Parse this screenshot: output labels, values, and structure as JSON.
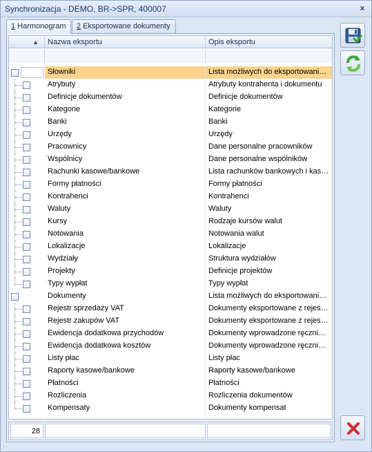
{
  "window": {
    "title": "Synchronizacja - DEMO, BR->SPR, 400007",
    "close_glyph": "×"
  },
  "tabs": [
    {
      "key": "1",
      "label": " Harmonogram",
      "active": true
    },
    {
      "key": "2",
      "label": " Eksportowane dokumenty",
      "active": false
    }
  ],
  "grid": {
    "sort_glyph": "▲",
    "columns": [
      "Nazwa eksportu",
      "Opis eksportu"
    ],
    "rows": [
      {
        "level": 0,
        "name": "Słowniki",
        "desc": "Lista możliwych do eksportowania słowników",
        "selected": true
      },
      {
        "level": 1,
        "name": "Atrybuty",
        "desc": "Atrybuty kontrahenta i dokumentu"
      },
      {
        "level": 1,
        "name": "Definicje dokumentów",
        "desc": "Definicje dokumentów"
      },
      {
        "level": 1,
        "name": "Kategorie",
        "desc": "Kategorie"
      },
      {
        "level": 1,
        "name": "Banki",
        "desc": "Banki"
      },
      {
        "level": 1,
        "name": "Urzędy",
        "desc": "Urzędy"
      },
      {
        "level": 1,
        "name": "Pracownicy",
        "desc": "Dane personalne pracowników"
      },
      {
        "level": 1,
        "name": "Wspólnicy",
        "desc": "Dane personalne wspólników"
      },
      {
        "level": 1,
        "name": "Rachunki kasowe/bankowe",
        "desc": "Lista rachunków bankowych i kas gotówkowych"
      },
      {
        "level": 1,
        "name": "Formy płatności",
        "desc": "Formy płatności"
      },
      {
        "level": 1,
        "name": "Kontrahenci",
        "desc": "Kontrahenci"
      },
      {
        "level": 1,
        "name": "Waluty",
        "desc": "Waluty"
      },
      {
        "level": 1,
        "name": "Kursy",
        "desc": "Rodzaje kursów walut"
      },
      {
        "level": 1,
        "name": "Notowania",
        "desc": "Notowania walut"
      },
      {
        "level": 1,
        "name": "Lokalizacje",
        "desc": "Lokalizacje"
      },
      {
        "level": 1,
        "name": "Wydziały",
        "desc": "Struktura wydziałów"
      },
      {
        "level": 1,
        "name": "Projekty",
        "desc": "Definicje projektów"
      },
      {
        "level": 1,
        "name": "Typy wypłat",
        "desc": "Typy wypłat"
      },
      {
        "level": 0,
        "name": "Dokumenty",
        "desc": "Lista możliwych do eksportowania dokumentów"
      },
      {
        "level": 1,
        "name": "Rejestr sprzedaży VAT",
        "desc": "Dokumenty eksportowane z rejestru sprzedaży"
      },
      {
        "level": 1,
        "name": "Rejestr zakupów VAT",
        "desc": "Dokumenty eksportowane z rejestru zakupów"
      },
      {
        "level": 1,
        "name": "Ewidencja dodatkowa przychodów",
        "desc": "Dokumenty wprowadzone ręcznie do ewidencji"
      },
      {
        "level": 1,
        "name": "Ewidencja dodatkowa kosztów",
        "desc": "Dokumenty wprowadzone ręcznie do ewidencji"
      },
      {
        "level": 1,
        "name": "Listy płac",
        "desc": "Listy płac"
      },
      {
        "level": 1,
        "name": "Raporty kasowe/bankowe",
        "desc": "Raporty kasowe/bankowe"
      },
      {
        "level": 1,
        "name": "Płatności",
        "desc": "Płatności"
      },
      {
        "level": 1,
        "name": "Rozliczenia",
        "desc": "Rozliczenia dokumentów"
      },
      {
        "level": 1,
        "name": "Kompensaty",
        "desc": "Dokumenty kompensat"
      }
    ],
    "row_count": "28"
  },
  "buttons": {
    "save_icon": "save-floppy-icon",
    "sync_icon": "sync-arrows-icon",
    "cancel_icon": "red-x-icon"
  },
  "colors": {
    "selected_row": "#fbd38c",
    "cancel_red": "#d42a2a",
    "sync_green": "#3aa63a"
  }
}
